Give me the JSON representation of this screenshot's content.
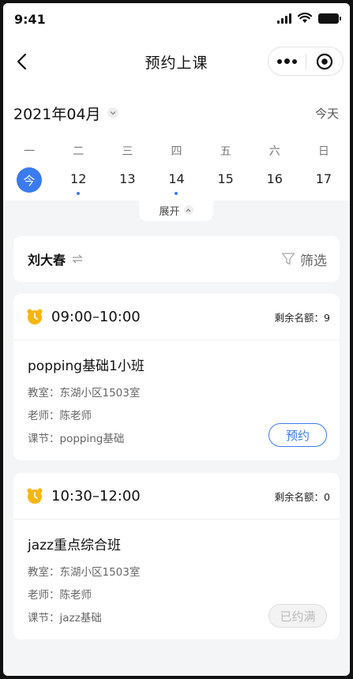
{
  "status_bar": {
    "time": "9:41"
  },
  "nav": {
    "title": "预约上课"
  },
  "calendar": {
    "month": "2021年04月",
    "today_label": "今天",
    "weekdays": [
      "一",
      "二",
      "三",
      "四",
      "五",
      "六",
      "日"
    ],
    "today_badge": "今",
    "days": [
      "12",
      "13",
      "14",
      "15",
      "16",
      "17"
    ],
    "expand_label": "展开"
  },
  "filter": {
    "teacher": "刘大春",
    "filter_label": "筛选"
  },
  "colors": {
    "accent": "#3a7bf0",
    "alarm": "#f5b60f",
    "background": "#f4f5f7"
  },
  "classes": [
    {
      "time": "09:00–10:00",
      "remain": "剩余名额：9",
      "name": "popping基础1小班",
      "room_label": "教室：",
      "room": "东湖小区1503室",
      "teacher_label": "老师：",
      "teacher": "陈老师",
      "lesson_label": "课节：",
      "lesson": "popping基础",
      "button": "预约"
    },
    {
      "time": "10:30–12:00",
      "remain": "剩余名额：0",
      "name": "jazz重点综合班",
      "room_label": "教室：",
      "room": "东湖小区1503室",
      "teacher_label": "老师：",
      "teacher": "陈老师",
      "lesson_label": "课节：",
      "lesson": "jazz基础",
      "button": "已约满"
    }
  ]
}
